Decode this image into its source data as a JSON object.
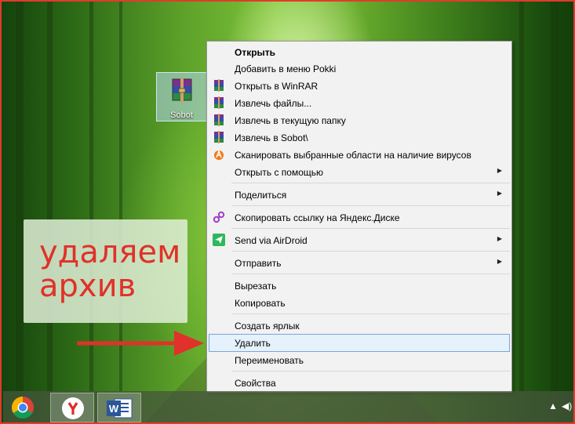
{
  "desktop": {
    "icon_label": "Sobot"
  },
  "note": {
    "line1": "удаляем",
    "line2": "архив"
  },
  "context_menu": {
    "items": [
      {
        "label": "Открыть"
      },
      {
        "label": "Добавить в меню Pokki"
      },
      {
        "label": "Открыть в WinRAR"
      },
      {
        "label": "Извлечь файлы..."
      },
      {
        "label": "Извлечь в текущую папку"
      },
      {
        "label": "Извлечь в Sobot\\"
      },
      {
        "label": "Сканировать выбранные области на наличие вирусов"
      },
      {
        "label": "Открыть с помощью"
      },
      {
        "label": "Поделиться"
      },
      {
        "label": "Скопировать ссылку на Яндекс.Диске"
      },
      {
        "label": "Send via AirDroid"
      },
      {
        "label": "Отправить"
      },
      {
        "label": "Вырезать"
      },
      {
        "label": "Копировать"
      },
      {
        "label": "Создать ярлык"
      },
      {
        "label": "Удалить"
      },
      {
        "label": "Переименовать"
      },
      {
        "label": "Свойства"
      }
    ],
    "highlighted_item": "Удалить"
  },
  "taskbar": {
    "apps": [
      {
        "icon": "chrome-icon"
      },
      {
        "icon": "yandex-browser-icon"
      },
      {
        "icon": "word-icon"
      }
    ]
  },
  "colors": {
    "annotation_red": "#e0312a",
    "menu_background": "#f2f2f2",
    "highlight": "#e5f1fb"
  }
}
